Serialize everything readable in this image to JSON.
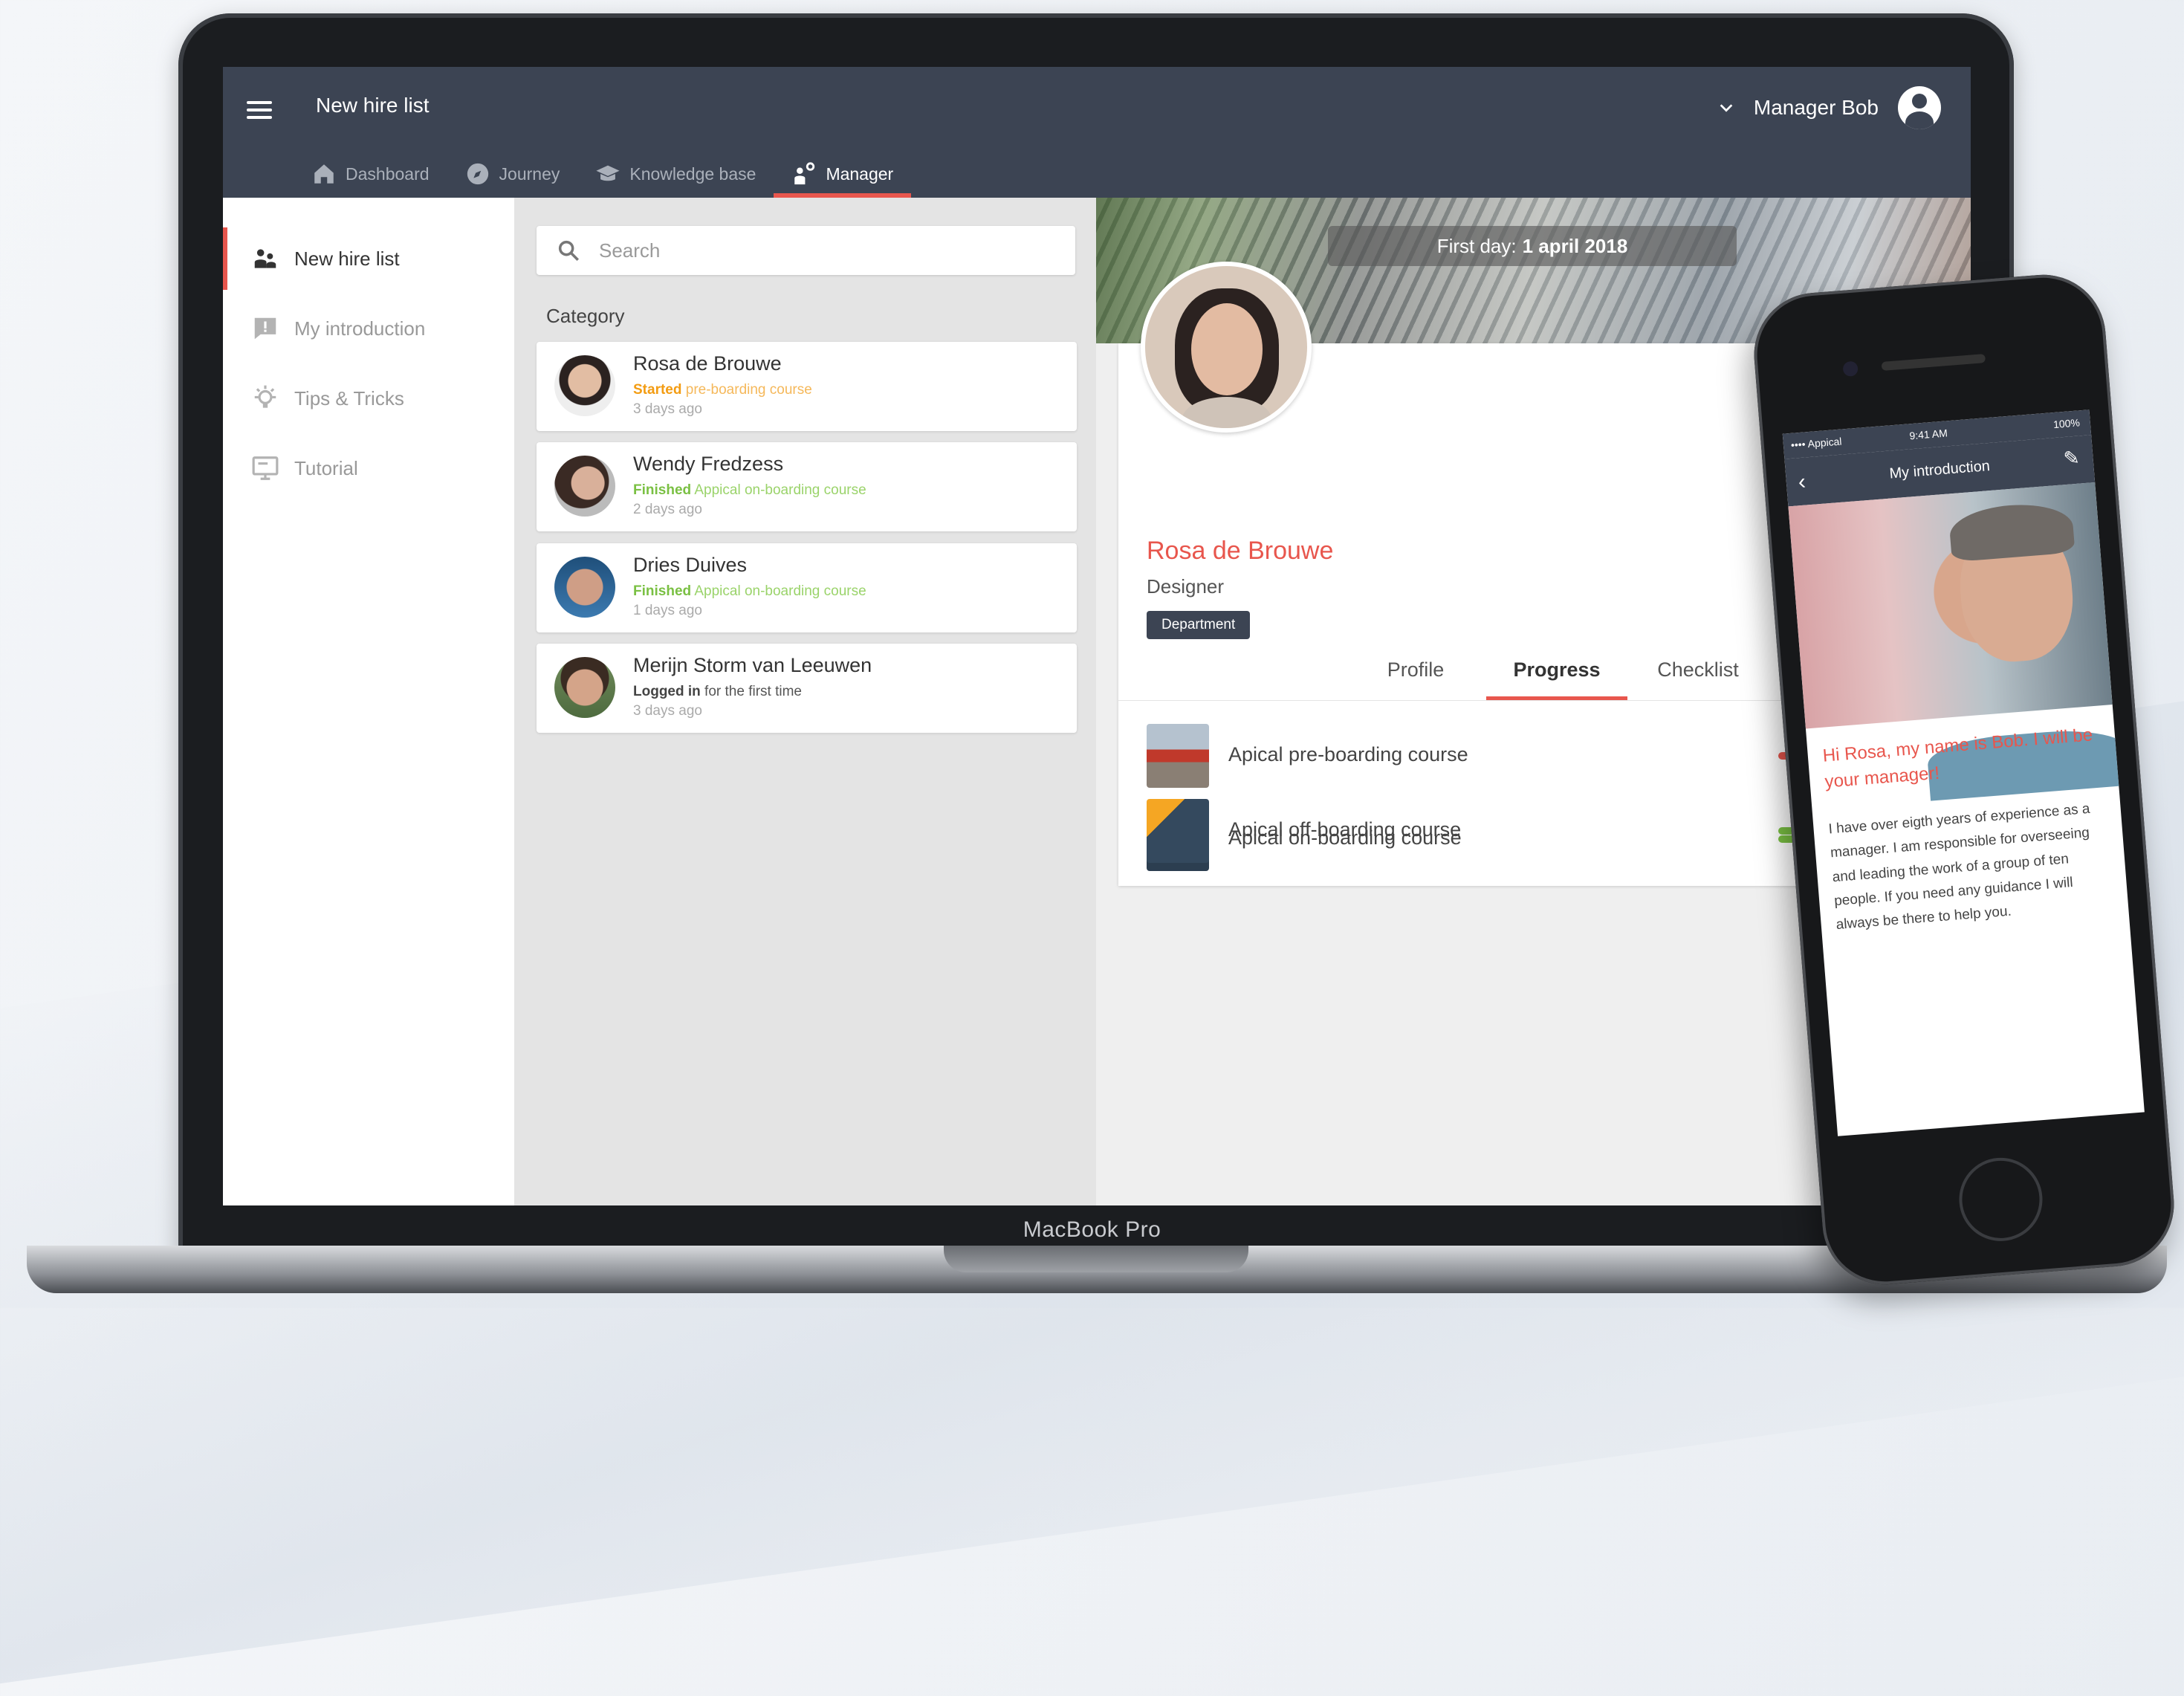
{
  "app": {
    "title": "New hire list",
    "user_name": "Manager Bob",
    "accent": "#e8564d",
    "bar_color": "#3c4453"
  },
  "nav": [
    {
      "label": "Dashboard",
      "icon": "home-icon"
    },
    {
      "label": "Journey",
      "icon": "compass-icon"
    },
    {
      "label": "Knowledge base",
      "icon": "graduation-cap-icon"
    },
    {
      "label": "Manager",
      "icon": "manager-icon",
      "active": true
    }
  ],
  "sidebar": {
    "items": [
      {
        "label": "New hire list",
        "icon": "people-icon",
        "active": true
      },
      {
        "label": "My introduction",
        "icon": "speech-bubble-icon"
      },
      {
        "label": "Tips & Tricks",
        "icon": "lightbulb-icon"
      },
      {
        "label": "Tutorial",
        "icon": "monitor-icon"
      }
    ]
  },
  "search": {
    "placeholder": "Search"
  },
  "list": {
    "category_label": "Category",
    "hires": [
      {
        "name": "Rosa de Brouwe",
        "status": "Started",
        "course": "pre-boarding course",
        "ago": "3 days ago",
        "kind": "started"
      },
      {
        "name": "Wendy Fredzess",
        "status": "Finished",
        "course": "Appical on-boarding course",
        "ago": "2 days ago",
        "kind": "finished"
      },
      {
        "name": "Dries Duives",
        "status": "Finished",
        "course": "Appical on-boarding course",
        "ago": "1 days ago",
        "kind": "finished"
      },
      {
        "name": "Merijn Storm van Leeuwen",
        "status": "Logged in",
        "course": "for the first time",
        "ago": "3 days ago",
        "kind": "logged"
      }
    ]
  },
  "detail": {
    "first_day_label": "First day:",
    "first_day_value": "1 april 2018",
    "name": "Rosa de Brouwe",
    "role": "Designer",
    "department": "Department",
    "tabs": [
      "Profile",
      "Progress",
      "Checklist"
    ],
    "active_tab": "Progress",
    "courses": [
      {
        "title": "Apical pre-boarding course",
        "bar_color": "#e8564d"
      },
      {
        "title": "Apical on-boarding course",
        "bar_color": "#7ac043"
      },
      {
        "title": "Apical off-boarding course",
        "bar_color": "#7ac043"
      }
    ]
  },
  "device": {
    "laptop_label": "MacBook Pro"
  },
  "phone": {
    "carrier": "•••• Appical",
    "time": "9:41 AM",
    "battery": "100%",
    "title": "My introduction",
    "greeting": "Hi Rosa, my name is Bob. I will be your manager!",
    "body": "I have over eigth years of experience as a manager. I am responsible for overseeing and leading the work of a group of ten people. If you need any guidance I will always be there to help you."
  }
}
